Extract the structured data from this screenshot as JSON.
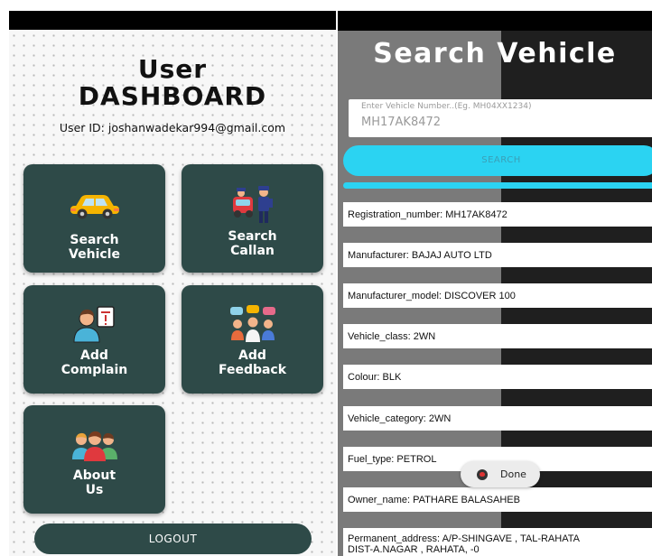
{
  "dashboard": {
    "title_line1": "User",
    "title_line2": "DASHBOARD",
    "user_id": "User ID: joshanwadekar994@gmail.com",
    "cards": [
      {
        "line1": "Search",
        "line2": "Vehicle",
        "icon": "car-icon"
      },
      {
        "line1": "Search",
        "line2": "Callan",
        "icon": "traffic-police-icon"
      },
      {
        "line1": "Add",
        "line2": "Complain",
        "icon": "complaint-person-icon"
      },
      {
        "line1": "Add",
        "line2": "Feedback",
        "icon": "feedback-group-icon"
      },
      {
        "line1": "About",
        "line2": "Us",
        "icon": "team-icon"
      }
    ],
    "logout_label": "LOGOUT",
    "colors": {
      "card": "#2e4a48",
      "background": "#f7f7f7"
    }
  },
  "search_vehicle": {
    "title": "Search Vehicle",
    "input_hint": "Enter Vehicle Number..(Eg. MH04XX1234)",
    "input_value": "MH17AK8472",
    "search_label": "SEARCH",
    "results": [
      "Registration_number: MH17AK8472",
      "Manufacturer: BAJAJ AUTO LTD",
      "Manufacturer_model: DISCOVER 100",
      "Vehicle_class: 2WN",
      "Colour: BLK",
      "Vehicle_category: 2WN",
      "Fuel_type: PETROL",
      "Owner_name: PATHARE BALASAHEB",
      "Permanent_address: A/P-SHINGAVE , TAL-RAHATA\nDIST-A.NAGAR , RAHATA, -0"
    ],
    "toast": "Done",
    "colors": {
      "accent": "#2bd3f2"
    }
  }
}
